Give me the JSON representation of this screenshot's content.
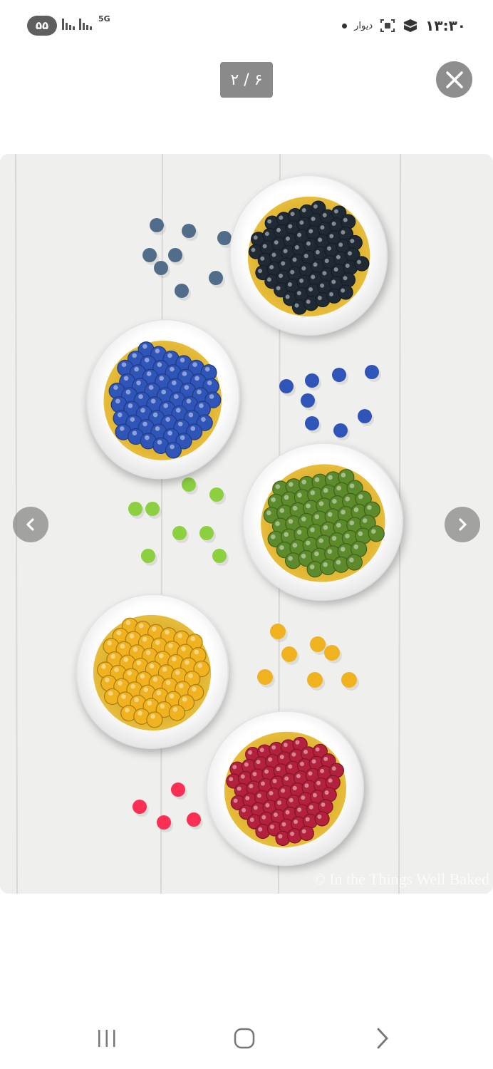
{
  "status_bar": {
    "battery": "۵۵",
    "network": "5G",
    "app_label": "دیوار",
    "time": "۱۳:۳۰"
  },
  "viewer": {
    "counter": "۲ / ۶",
    "watermark": "© In the Things Well Baked"
  },
  "icons": {
    "close": "close-icon",
    "prev": "chevron-left-icon",
    "next": "chevron-right-icon",
    "recents": "recents-icon",
    "home": "home-icon",
    "back": "back-icon"
  },
  "colors": {
    "black_pearls": "#1f2a35",
    "blue_pearls": "#2f55b8",
    "green_pearls": "#5d8a2a",
    "yellow_pearls": "#f0b21e",
    "pink_pearls": "#b3213c",
    "syrup": "#e0b02b"
  }
}
